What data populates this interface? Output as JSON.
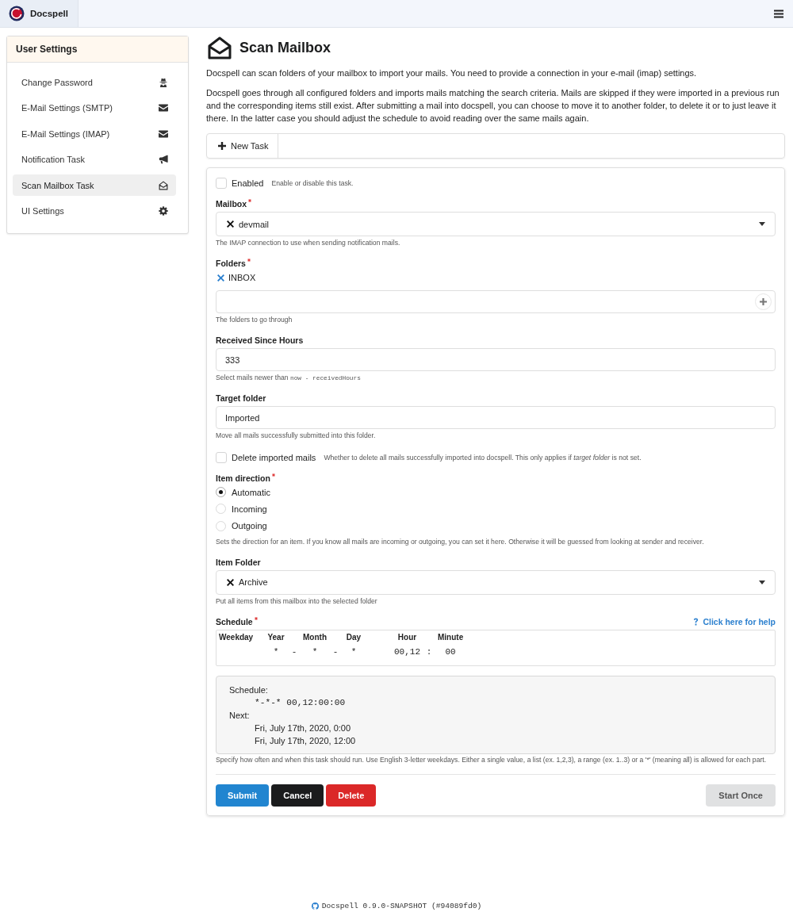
{
  "topbar": {
    "brand": "Docspell"
  },
  "sidebar": {
    "title": "User Settings",
    "items": [
      {
        "label": "Change Password",
        "kind": "password",
        "selected": false
      },
      {
        "label": "E-Mail Settings (SMTP)",
        "kind": "smtp",
        "selected": false
      },
      {
        "label": "E-Mail Settings (IMAP)",
        "kind": "imap",
        "selected": false
      },
      {
        "label": "Notification Task",
        "kind": "notification",
        "selected": false
      },
      {
        "label": "Scan Mailbox Task",
        "kind": "scan",
        "selected": true
      },
      {
        "label": "UI Settings",
        "kind": "ui",
        "selected": false
      }
    ]
  },
  "page": {
    "title": "Scan Mailbox",
    "intro": "Docspell can scan folders of your mailbox to import your mails. You need to provide a connection in your e-mail (imap) settings.",
    "description": "Docspell goes through all configured folders and imports mails matching the search criteria. Mails are skipped if they were imported in a previous run and the corresponding items still exist. After submitting a mail into docspell, you can choose to move it to another folder, to delete it or to just leave it there. In the latter case you should adjust the schedule to avoid reading over the same mails again."
  },
  "task_menu": {
    "new_task": "New Task"
  },
  "form": {
    "enabled": {
      "label": "Enabled",
      "hint": "Enable or disable this task.",
      "checked": false
    },
    "mailbox": {
      "label": "Mailbox",
      "required": true,
      "value": "devmail",
      "hint": "The IMAP connection to use when sending notification mails."
    },
    "folders": {
      "label": "Folders",
      "required": true,
      "items": [
        "INBOX"
      ],
      "hint": "The folders to go through"
    },
    "received_since": {
      "label": "Received Since Hours",
      "required": false,
      "value": "333",
      "hint": "Select mails newer than",
      "hint_code": "now - receivedHours"
    },
    "target_folder": {
      "label": "Target folder",
      "required": false,
      "value": "Imported",
      "hint": "Move all mails successfully submitted into this folder."
    },
    "delete_imported": {
      "label": "Delete imported mails",
      "checked": false,
      "hint": "Whether to delete all mails successfully imported into docspell. This only applies if *target folder* is not set."
    },
    "direction": {
      "label": "Item direction",
      "required": true,
      "options": [
        {
          "label": "Automatic",
          "selected": true
        },
        {
          "label": "Incoming",
          "selected": false
        },
        {
          "label": "Outgoing",
          "selected": false
        }
      ],
      "hint": "Sets the direction for an item. If you know all mails are incoming or outgoing, you can set it here. Otherwise it will be guessed from looking at sender and receiver."
    },
    "item_folder": {
      "label": "Item Folder",
      "required": false,
      "value": "Archive",
      "hint": "Put all items from this mailbox into the selected folder"
    },
    "schedule": {
      "label": "Schedule",
      "required": true,
      "help_link": "Click here for help",
      "editor": [
        {
          "kind": "field",
          "header": "Weekday"
        },
        {
          "kind": "field",
          "header": "Year",
          "value": "*"
        },
        {
          "kind": "separator",
          "value": "-"
        },
        {
          "kind": "field",
          "header": "Month",
          "value": "*"
        },
        {
          "kind": "separator",
          "value": "-"
        },
        {
          "kind": "field",
          "header": "Day",
          "value": "*"
        },
        {
          "kind": "field",
          "header": "Hour",
          "value": "00,12"
        },
        {
          "kind": "separator",
          "value": ":"
        },
        {
          "kind": "field",
          "header": "Minute",
          "value": "00"
        }
      ],
      "summary": {
        "schedule_label": "Schedule:",
        "expression": "*-*-* 00,12:00:00",
        "next_label": "Next:",
        "next_runs": [
          "Fri, July 17th, 2020, 0:00",
          "Fri, July 17th, 2020, 12:00"
        ]
      },
      "hint": "Specify how often and when this task should run. Use English 3-letter weekdays. Either a single value, a list (ex. 1,2,3), a range (ex. 1..3) or a '*' (meaning all) is allowed for each part."
    },
    "buttons": [
      {
        "label": "Submit",
        "kind": "submit"
      },
      {
        "label": "Cancel",
        "kind": "cancel"
      },
      {
        "label": "Delete",
        "kind": "delete"
      },
      {
        "label": "Start Once",
        "kind": "start"
      }
    ]
  },
  "footer": {
    "version": "Docspell 0.9.0-SNAPSHOT (#94089fd0)"
  }
}
